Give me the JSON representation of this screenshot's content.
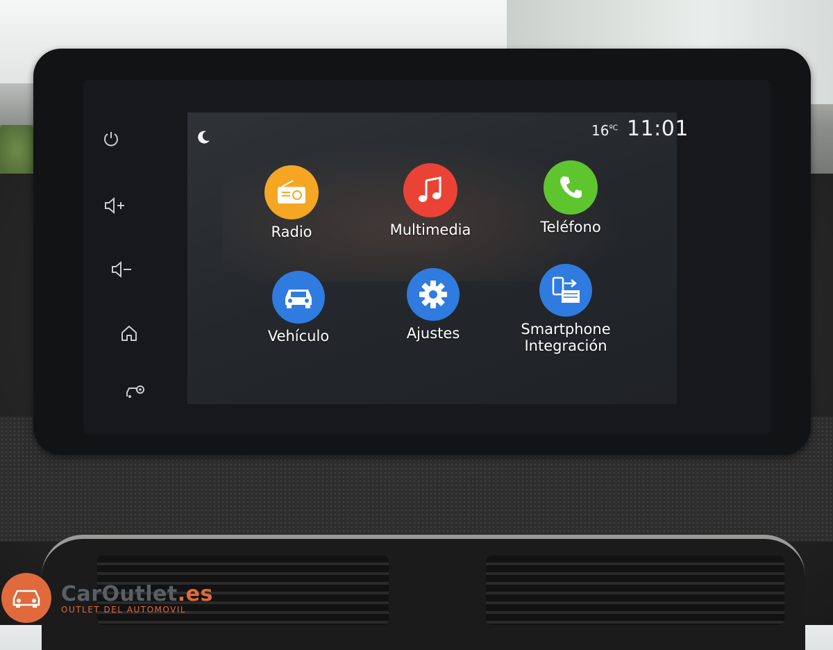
{
  "status": {
    "temperature": "16",
    "temperature_unit": "ºC",
    "time": "11:01",
    "night_mode_icon": "moon-icon"
  },
  "side_buttons": [
    {
      "name": "power-icon"
    },
    {
      "name": "volume-up-icon"
    },
    {
      "name": "volume-down-icon"
    },
    {
      "name": "home-icon"
    },
    {
      "name": "car-settings-icon"
    }
  ],
  "apps": [
    {
      "label": "Radio",
      "icon": "radio-icon",
      "color": "#f5a623"
    },
    {
      "label": "Multimedia",
      "icon": "music-note-icon",
      "color": "#ea4335"
    },
    {
      "label": "Teléfono",
      "icon": "phone-icon",
      "color": "#5fc52e"
    },
    {
      "label": "Vehículo",
      "icon": "vehicle-icon",
      "color": "#2f7be0"
    },
    {
      "label": "Ajustes",
      "icon": "gear-icon",
      "color": "#2f7be0"
    },
    {
      "label": "Smartphone\nIntegración",
      "icon": "smartphone-integration-icon",
      "color": "#2f7be0"
    }
  ],
  "watermark": {
    "name_prefix": "CarOutlet",
    "name_suffix": ".es",
    "tagline": "OUTLET DEL AUTOMOVIL"
  }
}
